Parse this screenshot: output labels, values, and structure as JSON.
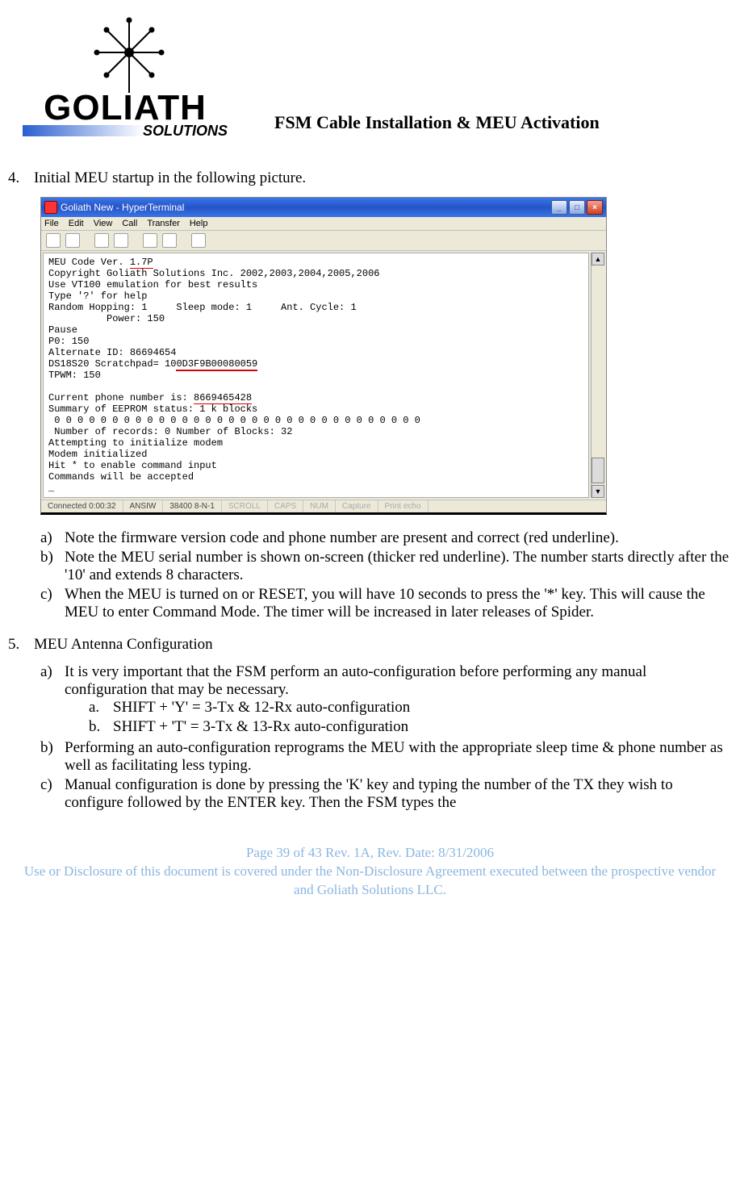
{
  "header": {
    "logo_text_main": "GOLIATH",
    "logo_text_sub": "SOLUTIONS",
    "title": "FSM Cable Installation & MEU Activation"
  },
  "step4": {
    "number": "4.",
    "text": "Initial MEU startup in the following picture."
  },
  "hyperterminal": {
    "window_title": "Goliath New - HyperTerminal",
    "menu": [
      "File",
      "Edit",
      "View",
      "Call",
      "Transfer",
      "Help"
    ],
    "terminal": {
      "line01a": "MEU Code Ver. ",
      "line01b_version": "1.7P",
      "line02": "Copyright Goliath Solutions Inc. 2002,2003,2004,2005,2006",
      "line03": "Use VT100 emulation for best results",
      "line04": "Type '?' for help",
      "line05": "Random Hopping: 1     Sleep mode: 1     Ant. Cycle: 1",
      "line06": "          Power: 150",
      "line07": "Pause",
      "line08": "P0: 150",
      "line09": "Alternate ID: 86694654",
      "line10a": "DS18S20 Scratchpad= 10",
      "line10b_serial": "0D3F9B00080059",
      "line11": "TPWM: 150",
      "line_blank1": "",
      "line12a": "Current phone number is: ",
      "line12b_phone": "8669465428",
      "line13": "Summary of EEPROM status: 1 k blocks",
      "line14": " 0 0 0 0 0 0 0 0 0 0 0 0 0 0 0 0 0 0 0 0 0 0 0 0 0 0 0 0 0 0 0 0",
      "line15": " Number of records: 0 Number of Blocks: 32",
      "line16": "Attempting to initialize modem",
      "line17": "Modem initialized",
      "line18": "Hit * to enable command input",
      "line19": "Commands will be accepted",
      "line20": "_"
    },
    "status": {
      "connected": "Connected 0:00:32",
      "emulation": "ANSIW",
      "settings": "38400 8-N-1",
      "scroll": "SCROLL",
      "caps": "CAPS",
      "num": "NUM",
      "capture": "Capture",
      "echo": "Print echo"
    }
  },
  "step4_notes": {
    "a": "Note the firmware version code and phone number are present and correct (red underline).",
    "b": "Note the MEU serial number is shown on-screen (thicker red underline). The number starts directly after the '10' and extends 8 characters.",
    "c": "When the MEU is turned on or RESET, you will have 10 seconds to press the '*' key. This will cause the MEU to enter Command Mode. The timer will be increased in later releases of Spider."
  },
  "step5": {
    "number": "5.",
    "text": "MEU Antenna Configuration",
    "a": "It is very important that the FSM perform an auto-configuration before performing any manual configuration that may be necessary.",
    "a_a": "SHIFT + 'Y' = 3-Tx & 12-Rx auto-configuration",
    "a_b": "SHIFT + 'T' = 3-Tx & 13-Rx auto-configuration",
    "b": "Performing an auto-configuration reprograms the MEU with the appropriate sleep time & phone number as well as facilitating less typing.",
    "c": "Manual configuration is done by pressing the 'K' key and typing the number of the TX they wish to configure followed by the ENTER key. Then the FSM types the"
  },
  "footer": {
    "line1": "Page 39 of 43     Rev. 1A,   Rev. Date: 8/31/2006",
    "line2": "Use or Disclosure of this document is covered under the Non-Disclosure Agreement executed between the prospective vendor and Goliath Solutions LLC."
  }
}
